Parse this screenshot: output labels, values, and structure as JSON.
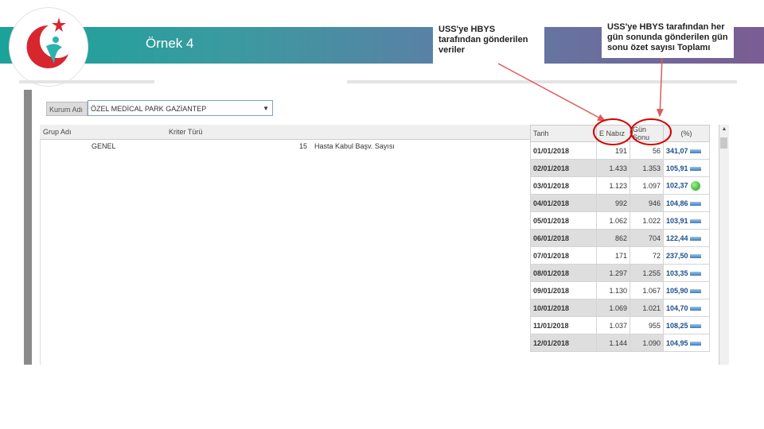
{
  "slide": {
    "title": "Örnek 4",
    "callout_1": "USS'ye HBYS tarafından gönderilen veriler",
    "callout_2": "USS'ye HBYS tarafından her gün sonunda gönderilen gün sonu özet sayısı Toplamı"
  },
  "filter": {
    "label": "Kurum Adı",
    "value": "ÖZEL MEDİCAL PARK GAZİANTEP"
  },
  "grid": {
    "headers": {
      "grup": "Grup Adı",
      "kriter": "Kriter Türü",
      "tarih": "Tarih",
      "enabiz": "E Nabız",
      "gunsonu": "Gün Sonu",
      "yuzde": "(%)"
    },
    "group": "GENEL",
    "criterion_no": "15",
    "criterion_name": "Hasta Kabul Başv. Sayısı",
    "rows": [
      {
        "date": "01/01/2018",
        "enabiz": "191",
        "gunsonu": "56",
        "pct": "341,07"
      },
      {
        "date": "02/01/2018",
        "enabiz": "1.433",
        "gunsonu": "1.353",
        "pct": "105,91"
      },
      {
        "date": "03/01/2018",
        "enabiz": "1.123",
        "gunsonu": "1.097",
        "pct": "102,37"
      },
      {
        "date": "04/01/2018",
        "enabiz": "992",
        "gunsonu": "946",
        "pct": "104,86"
      },
      {
        "date": "05/01/2018",
        "enabiz": "1.062",
        "gunsonu": "1.022",
        "pct": "103,91"
      },
      {
        "date": "06/01/2018",
        "enabiz": "862",
        "gunsonu": "704",
        "pct": "122,44"
      },
      {
        "date": "07/01/2018",
        "enabiz": "171",
        "gunsonu": "72",
        "pct": "237,50"
      },
      {
        "date": "08/01/2018",
        "enabiz": "1.297",
        "gunsonu": "1.255",
        "pct": "103,35"
      },
      {
        "date": "09/01/2018",
        "enabiz": "1.130",
        "gunsonu": "1.067",
        "pct": "105,90"
      },
      {
        "date": "10/01/2018",
        "enabiz": "1.069",
        "gunsonu": "1.021",
        "pct": "104,70"
      },
      {
        "date": "11/01/2018",
        "enabiz": "1.037",
        "gunsonu": "955",
        "pct": "108,25"
      },
      {
        "date": "12/01/2018",
        "enabiz": "1.144",
        "gunsonu": "1.090",
        "pct": "104,95"
      }
    ]
  },
  "colors": {
    "banner_start": "#1aa39a",
    "banner_end": "#7b5c93",
    "arrow": "#e05a5a",
    "circle": "#d40000",
    "logo_red": "#d8262e",
    "logo_teal": "#2bb3ac"
  }
}
